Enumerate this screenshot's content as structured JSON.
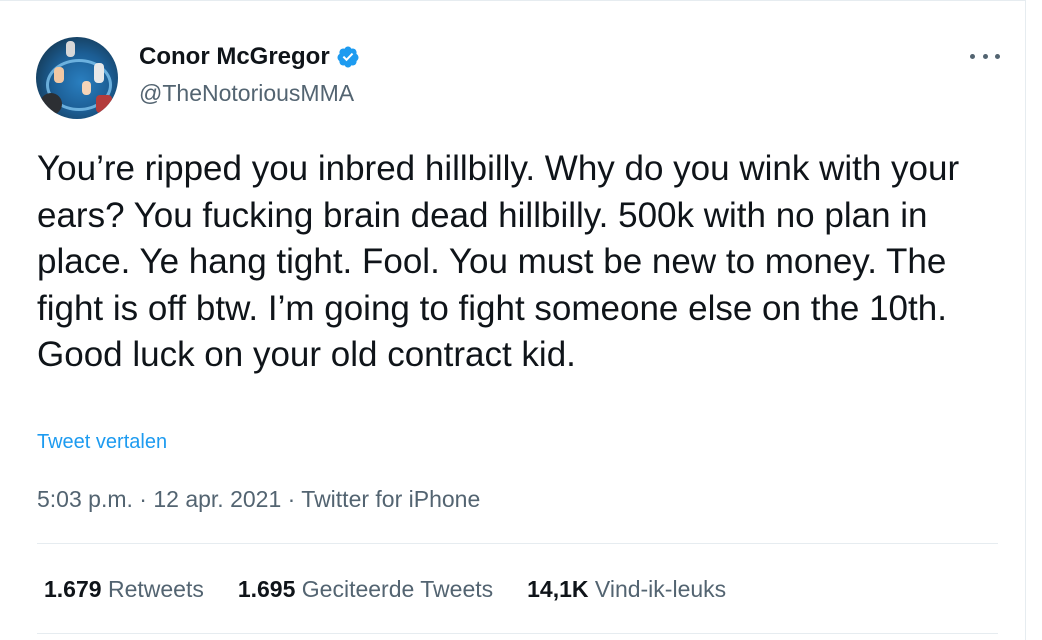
{
  "tweet": {
    "author": {
      "display_name": "Conor McGregor",
      "handle": "@TheNotoriousMMA",
      "verified": true
    },
    "text": "You’re ripped you inbred hillbilly. Why do you wink with your ears? You fucking brain dead hillbilly. 500k with no plan in place. Ye hang tight. Fool. You must be new to money. The fight is off btw. I’m going to fight someone else on the 10th. Good luck on your old contract kid.",
    "translate_label": "Tweet vertalen",
    "time": "5:03 p.m.",
    "separator": "·",
    "date": "12 apr. 2021",
    "source": "Twitter for iPhone",
    "stats": [
      {
        "count": "1.679",
        "label": "Retweets"
      },
      {
        "count": "1.695",
        "label": "Geciteerde Tweets"
      },
      {
        "count": "14,1K",
        "label": "Vind-ik-leuks"
      }
    ]
  },
  "icons": {
    "verified": "verified-badge-icon",
    "more": "more-options-icon"
  },
  "colors": {
    "accent": "#1d9bf0",
    "text": "#0f1419",
    "secondary": "#536471",
    "divider": "#e6ecf0"
  }
}
